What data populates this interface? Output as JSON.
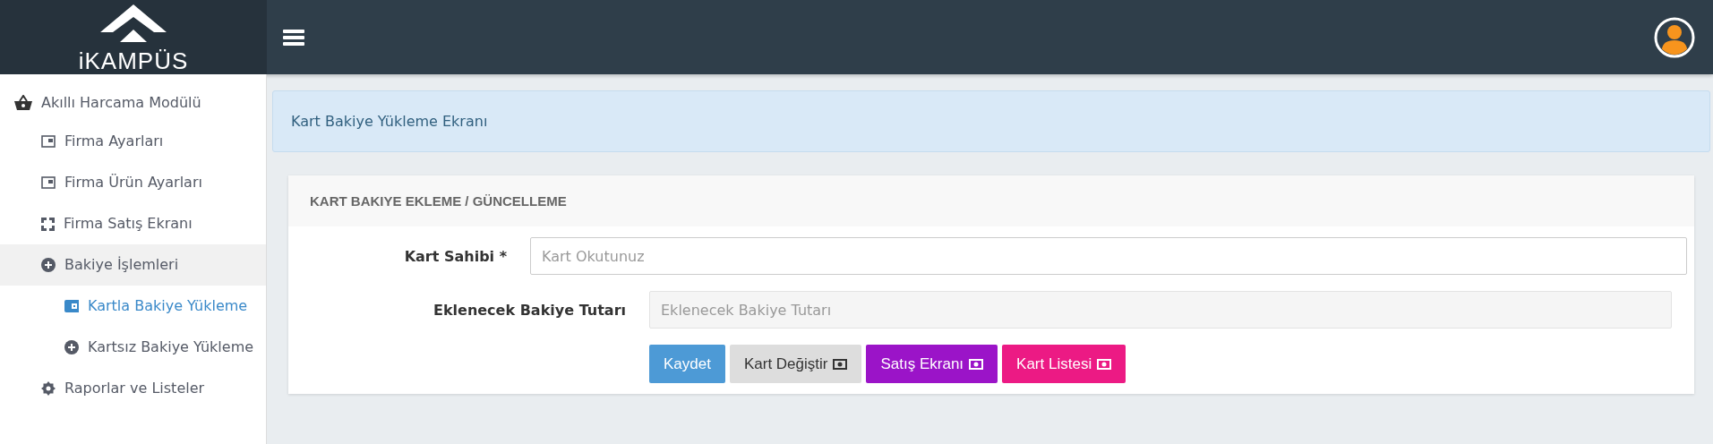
{
  "header": {
    "logo": "iKAMPÜS"
  },
  "sidebar": {
    "items": [
      {
        "label": "Akıllı Harcama Modülü",
        "kind": "basket",
        "selected": false,
        "children": [
          {
            "label": "Firma Ayarları",
            "kind": "window",
            "selected": false
          },
          {
            "label": "Firma Ürün Ayarları",
            "kind": "window",
            "selected": false
          },
          {
            "label": "Firma Satış Ekranı",
            "kind": "expand",
            "selected": false
          },
          {
            "label": "Bakiye İşlemleri",
            "kind": "plus",
            "selected": true,
            "children": [
              {
                "label": "Kartla Bakiye Yükleme",
                "kind": "wallet",
                "selected": true
              },
              {
                "label": "Kartsız Bakiye Yükleme",
                "kind": "plus",
                "selected": false
              }
            ]
          },
          {
            "label": "Raporlar ve Listeler",
            "kind": "gear",
            "selected": false
          }
        ]
      }
    ]
  },
  "alert": "Kart Bakiye Yükleme Ekranı",
  "card": {
    "title": "KART BAKIYE EKLEME / GÜNCELLEME",
    "fields": [
      {
        "label": "Kart Sahibi *",
        "placeholder": "Kart Okutunuz",
        "disabled": false
      },
      {
        "label": "Eklenecek Bakiye Tutarı",
        "placeholder": "Eklenecek Bakiye Tutarı",
        "disabled": true
      }
    ],
    "buttons": [
      {
        "label": "Kaydet",
        "color": "#4d9ad6",
        "icon": false
      },
      {
        "label": "Kart Değiştir",
        "color": "#dddddd",
        "icon": true
      },
      {
        "label": "Satış Ekranı",
        "color": "#9b14c8",
        "icon": true
      },
      {
        "label": "Kart Listesi",
        "color": "#ec1a84",
        "icon": true
      }
    ]
  }
}
